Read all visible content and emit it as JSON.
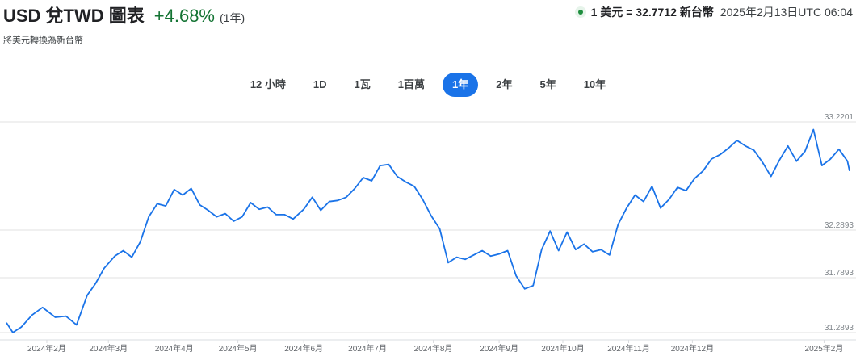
{
  "header": {
    "title": "USD 兌TWD 圖表",
    "change": "+4.68%",
    "period": "(1年)",
    "subtitle": "將美元轉換為新台幣"
  },
  "rate": {
    "value": "1 美元 = 32.7712 新台幣",
    "timestamp": "2025年2月13日UTC 06:04"
  },
  "tabs": [
    {
      "label": "12 小時",
      "active": false
    },
    {
      "label": "1D",
      "active": false
    },
    {
      "label": "1瓦",
      "active": false
    },
    {
      "label": "1百萬",
      "active": false
    },
    {
      "label": "1年",
      "active": true
    },
    {
      "label": "2年",
      "active": false
    },
    {
      "label": "5年",
      "active": false
    },
    {
      "label": "10年",
      "active": false
    }
  ],
  "colors": {
    "line": "#1a73e8",
    "accent": "#1a73e8",
    "positive": "#137333",
    "grid": "#e0e0e0"
  },
  "chart_data": {
    "type": "line",
    "title": "",
    "xlabel": "",
    "ylabel": "",
    "ylim": [
      31.2893,
      33.2201
    ],
    "y_ticks": [
      "33.2201",
      "32.2893",
      "31.7893",
      "31.2893"
    ],
    "y_tick_values": [
      33.2201,
      32.2893,
      31.7893,
      31.2893
    ],
    "x_ticks": [
      "2024年2月",
      "2024年3月",
      "2024年4月",
      "2024年5月",
      "2024年6月",
      "2024年7月",
      "2024年8月",
      "2024年9月",
      "2024年10月",
      "2024年11月",
      "2024年12月",
      "2025年2月"
    ],
    "x_tick_dates": [
      "2024-02-01",
      "2024-03-01",
      "2024-04-01",
      "2024-05-01",
      "2024-06-01",
      "2024-07-01",
      "2024-08-01",
      "2024-09-01",
      "2024-10-01",
      "2024-11-01",
      "2024-12-01",
      "2025-02-01"
    ],
    "series": [
      {
        "x": [
          "2024-01-13",
          "2024-01-16",
          "2024-01-20",
          "2024-01-25",
          "2024-01-30",
          "2024-02-05",
          "2024-02-10",
          "2024-02-15",
          "2024-02-20",
          "2024-02-24",
          "2024-02-28",
          "2024-03-04",
          "2024-03-08",
          "2024-03-12",
          "2024-03-16",
          "2024-03-20",
          "2024-03-24",
          "2024-03-28",
          "2024-04-01",
          "2024-04-05",
          "2024-04-09",
          "2024-04-13",
          "2024-04-17",
          "2024-04-21",
          "2024-04-25",
          "2024-04-29",
          "2024-05-03",
          "2024-05-07",
          "2024-05-11",
          "2024-05-15",
          "2024-05-19",
          "2024-05-23",
          "2024-05-27",
          "2024-06-01",
          "2024-06-05",
          "2024-06-09",
          "2024-06-13",
          "2024-06-17",
          "2024-06-21",
          "2024-06-25",
          "2024-06-29",
          "2024-07-03",
          "2024-07-07",
          "2024-07-11",
          "2024-07-15",
          "2024-07-19",
          "2024-07-23",
          "2024-07-27",
          "2024-07-31",
          "2024-08-04",
          "2024-08-08",
          "2024-08-12",
          "2024-08-16",
          "2024-08-20",
          "2024-08-24",
          "2024-08-28",
          "2024-09-01",
          "2024-09-05",
          "2024-09-09",
          "2024-09-13",
          "2024-09-17",
          "2024-09-21",
          "2024-09-25",
          "2024-09-29",
          "2024-10-03",
          "2024-10-07",
          "2024-10-11",
          "2024-10-15",
          "2024-10-19",
          "2024-10-23",
          "2024-10-27",
          "2024-10-31",
          "2024-11-04",
          "2024-11-08",
          "2024-11-12",
          "2024-11-16",
          "2024-11-20",
          "2024-11-24",
          "2024-11-28",
          "2024-12-02",
          "2024-12-06",
          "2024-12-10",
          "2024-12-14",
          "2024-12-18",
          "2024-12-22",
          "2024-12-26",
          "2024-12-30",
          "2025-01-03",
          "2025-01-07",
          "2025-01-11",
          "2025-01-15",
          "2025-01-19",
          "2025-01-23",
          "2025-01-27",
          "2025-01-31",
          "2025-02-04",
          "2025-02-08",
          "2025-02-12",
          "2025-02-13"
        ],
        "values": [
          31.38,
          31.29,
          31.34,
          31.45,
          31.52,
          31.43,
          31.44,
          31.36,
          31.63,
          31.74,
          31.88,
          31.99,
          32.04,
          31.98,
          32.12,
          32.35,
          32.47,
          32.45,
          32.6,
          32.55,
          32.61,
          32.46,
          32.41,
          32.35,
          32.38,
          32.31,
          32.35,
          32.48,
          32.42,
          32.44,
          32.37,
          32.37,
          32.33,
          32.42,
          32.53,
          32.41,
          32.49,
          32.5,
          32.53,
          32.61,
          32.71,
          32.68,
          32.82,
          32.83,
          32.72,
          32.67,
          32.63,
          32.51,
          32.36,
          32.24,
          31.93,
          31.98,
          31.96,
          32.0,
          32.04,
          31.99,
          32.01,
          32.04,
          31.81,
          31.69,
          31.72,
          32.05,
          32.22,
          32.04,
          32.21,
          32.05,
          32.1,
          32.03,
          32.05,
          32.0,
          32.28,
          32.43,
          32.55,
          32.49,
          32.63,
          32.43,
          32.51,
          32.62,
          32.59,
          32.7,
          32.77,
          32.88,
          32.92,
          32.98,
          33.05,
          33.0,
          32.96,
          32.85,
          32.72,
          32.87,
          33.0,
          32.86,
          32.95,
          33.15,
          32.82,
          32.88,
          32.97,
          32.86,
          32.77
        ]
      }
    ]
  }
}
